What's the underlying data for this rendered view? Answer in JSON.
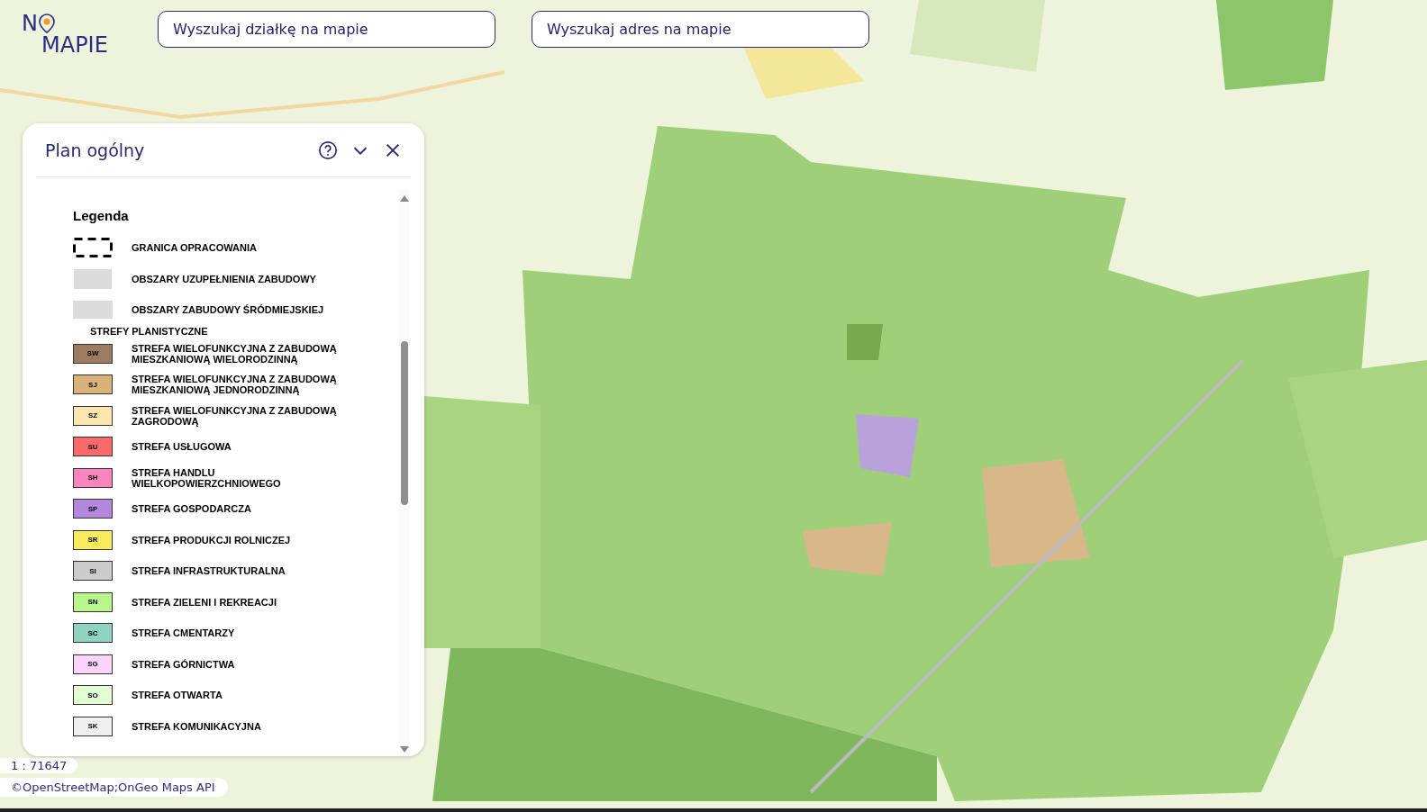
{
  "logo": {
    "first": "N",
    "second": "MAPIE"
  },
  "search_fields": [
    {
      "placeholder": "Wyszukaj działkę na mapie"
    },
    {
      "placeholder": "Wyszukaj adres na mapie"
    }
  ],
  "panel": {
    "title": "Plan ogólny",
    "legend_title": "Legenda",
    "items": [
      {
        "kind": "border",
        "label": "GRANICA OPRACOWANIA"
      },
      {
        "kind": "vhatch",
        "label": "OBSZARY UZUPEŁNIENIA ZABUDOWY"
      },
      {
        "kind": "hhatch",
        "label": "OBSZARY ZABUDOWY ŚRÓDMIEJSKIEJ"
      },
      {
        "kind": "heading",
        "label": "STREFY PLANISTYCZNE"
      },
      {
        "kind": "swatch",
        "code": "SW",
        "color": "#9c7b61",
        "label": "STREFA WIELOFUNKCYJNA Z ZABUDOWĄ MIESZKANIOWĄ WIELORODZINNĄ"
      },
      {
        "kind": "swatch",
        "code": "SJ",
        "color": "#d9b27a",
        "label": "STREFA WIELOFUNKCYJNA Z ZABUDOWĄ MIESZKANIOWĄ JEDNORODZINNĄ"
      },
      {
        "kind": "swatch",
        "code": "SZ",
        "color": "#fde5b0",
        "label": "STREFA WIELOFUNKCYJNA Z ZABUDOWĄ ZAGRODOWĄ"
      },
      {
        "kind": "swatch",
        "code": "SU",
        "color": "#fa6a6a",
        "label": "STREFA USŁUGOWA"
      },
      {
        "kind": "swatch",
        "code": "SH",
        "color": "#f985be",
        "label": "STREFA HANDLU WIELKOPOWIERZCHNIOWEGO"
      },
      {
        "kind": "swatch",
        "code": "SP",
        "color": "#b387de",
        "label": "STREFA GOSPODARCZA"
      },
      {
        "kind": "swatch",
        "code": "SR",
        "color": "#fbeb5e",
        "label": "STREFA PRODUKCJI ROLNICZEJ"
      },
      {
        "kind": "swatch",
        "code": "SI",
        "color": "#cbcbcb",
        "label": "STREFA INFRASTRUKTURALNA"
      },
      {
        "kind": "swatch",
        "code": "SN",
        "color": "#b8f58a",
        "label": "STREFA ZIELENI I REKREACJI"
      },
      {
        "kind": "swatch",
        "code": "SC",
        "color": "#8fd3c3",
        "label": "STREFA CMENTARZY"
      },
      {
        "kind": "swatch",
        "code": "SG",
        "color": "#fad4fb",
        "label": "STREFA GÓRNICTWA"
      },
      {
        "kind": "swatch",
        "code": "SO",
        "color": "#e2fdd2",
        "label": "STREFA OTWARTA"
      },
      {
        "kind": "swatch",
        "code": "SK",
        "color": "#efefef",
        "label": "STREFA KOMUNIKACYJNA"
      }
    ]
  },
  "scale": "1 : 71647",
  "attribution": "©OpenStreetMap;OnGeo Maps API"
}
